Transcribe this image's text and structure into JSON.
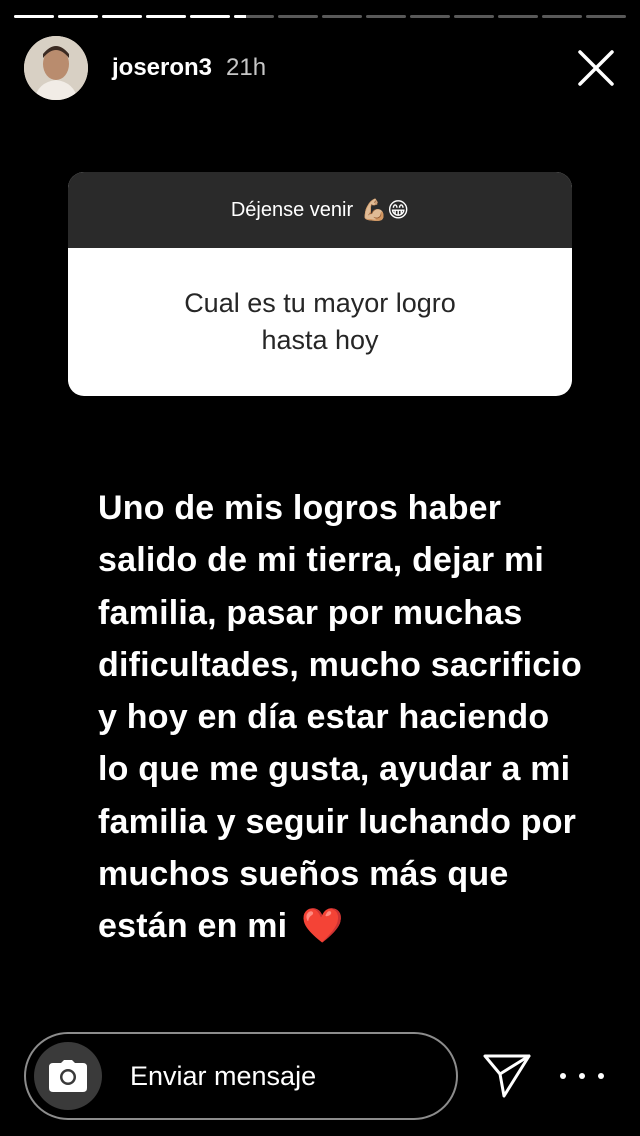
{
  "story": {
    "progress_segments": [
      1,
      1,
      1,
      1,
      1,
      0.3,
      0,
      0,
      0,
      0,
      0,
      0,
      0,
      0
    ]
  },
  "header": {
    "username": "joseron3",
    "time": "21h"
  },
  "question_sticker": {
    "prompt": "Déjense venir",
    "prompt_emoji": "💪🏼😁",
    "question": "Cual es tu mayor logro hasta hoy"
  },
  "answer": {
    "text": "Uno de mis logros haber salido de mi tierra, dejar mi familia, pasar por muchas dificultades, mucho sacrificio y hoy en día estar haciendo lo que me gusta, ayudar a mi familia y seguir luchando por muchos sueños más que están en mi",
    "emoji": "❤️"
  },
  "composer": {
    "placeholder": "Enviar mensaje"
  },
  "icons": {
    "close": "close-icon",
    "camera": "camera-icon",
    "send": "send-icon",
    "more": "more-icon"
  }
}
